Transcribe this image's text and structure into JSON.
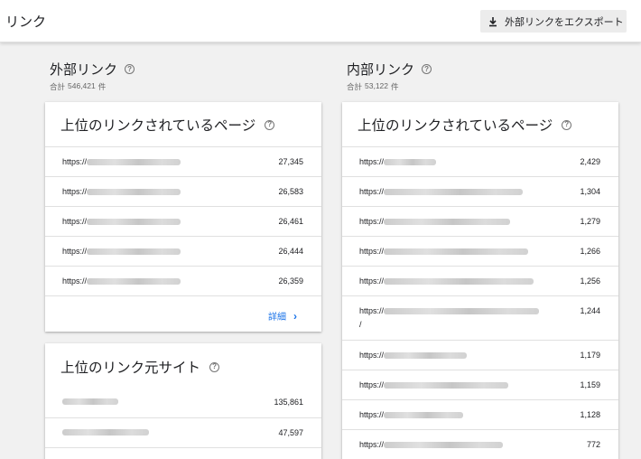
{
  "header": {
    "title": "リンク",
    "export_label": "外部リンクをエクスポート"
  },
  "external": {
    "title": "外部リンク",
    "total_prefix": "合計",
    "total_value": "546,421",
    "total_unit": "件",
    "top_pages": {
      "title": "上位のリンクされているページ",
      "rows": [
        {
          "url": "https://",
          "value": "27,345"
        },
        {
          "url": "https://",
          "value": "26,583"
        },
        {
          "url": "https://",
          "value": "26,461"
        },
        {
          "url": "https://",
          "value": "26,444"
        },
        {
          "url": "https://",
          "value": "26,359"
        }
      ],
      "detail_label": "詳細"
    },
    "top_sites": {
      "title": "上位のリンク元サイト",
      "rows": [
        {
          "value": "135,861"
        },
        {
          "value": "47,597"
        }
      ]
    }
  },
  "internal": {
    "title": "内部リンク",
    "total_prefix": "合計",
    "total_value": "53,122",
    "total_unit": "件",
    "top_pages": {
      "title": "上位のリンクされているページ",
      "rows": [
        {
          "url": "https://",
          "value": "2,429"
        },
        {
          "url": "https://",
          "value": "1,304"
        },
        {
          "url": "https://",
          "value": "1,279"
        },
        {
          "url": "https://",
          "value": "1,266"
        },
        {
          "url": "https://",
          "value": "1,256"
        },
        {
          "url": "https://",
          "value": "1,244",
          "suffix": "/"
        },
        {
          "url": "https://",
          "value": "1,179"
        },
        {
          "url": "https://",
          "value": "1,159"
        },
        {
          "url": "https://",
          "value": "1,128"
        },
        {
          "url": "https://",
          "value": "772"
        }
      ]
    }
  }
}
